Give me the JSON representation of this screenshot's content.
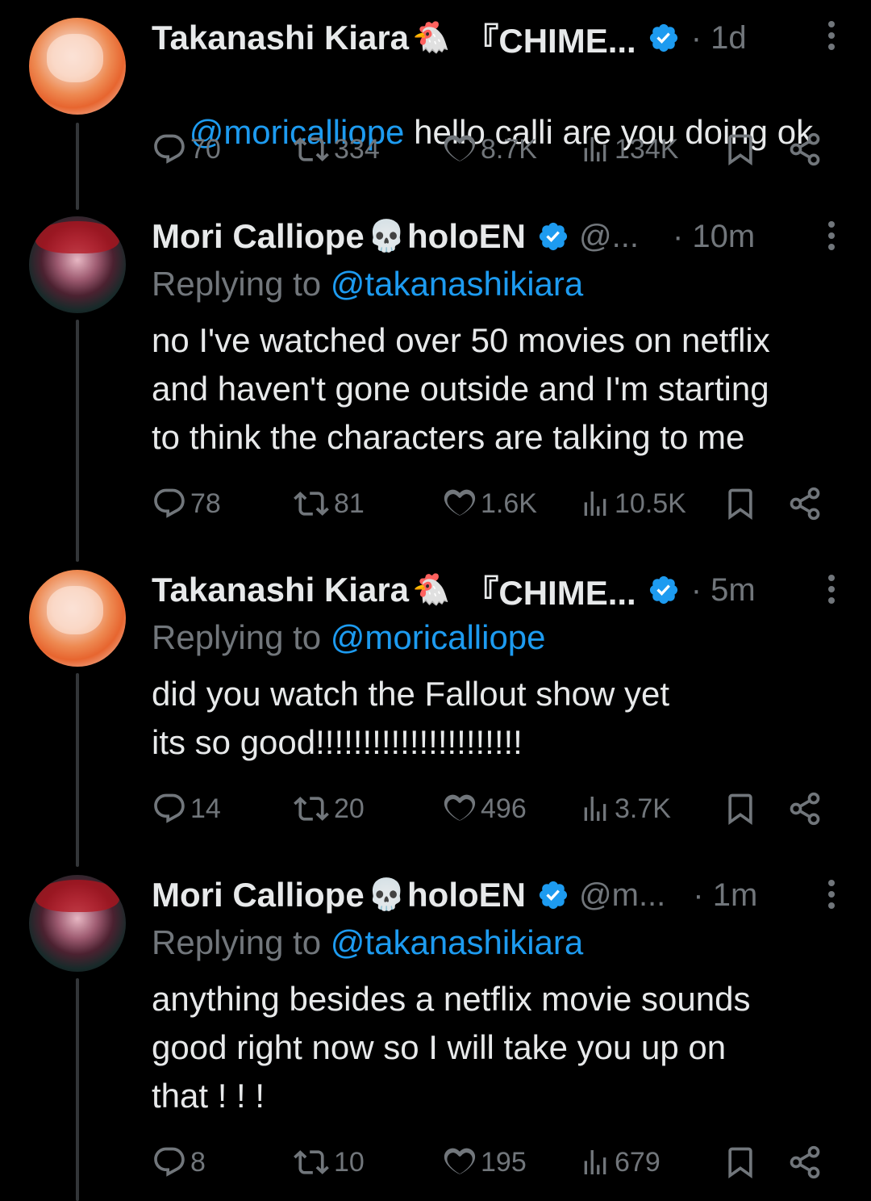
{
  "tweets": [
    {
      "name": "Takanashi Kiara",
      "emoji": "🐔",
      "extra_name": "『CHIME...",
      "handle": "",
      "time": "· 1d",
      "reply_prefix": "",
      "reply_handle": "",
      "mention": "@moricalliope",
      "text": " hello calli are you doing ok",
      "replies": "70",
      "retweets": "334",
      "likes": "8.7K",
      "views": "134K"
    },
    {
      "name": "Mori Calliope",
      "emoji": "💀",
      "extra_name": "holoEN",
      "handle": "@...",
      "time": "· 10m",
      "reply_prefix": "Replying to ",
      "reply_handle": "@takanashikiara",
      "text": "no I've watched over 50 movies on netflix\nand haven't gone outside and I'm starting\nto think the characters are talking to me",
      "replies": "78",
      "retweets": "81",
      "likes": "1.6K",
      "views": "10.5K"
    },
    {
      "name": "Takanashi Kiara",
      "emoji": "🐔",
      "extra_name": "『CHIME...",
      "handle": "",
      "time": "· 5m",
      "reply_prefix": "Replying to ",
      "reply_handle": "@moricalliope",
      "text": "did you watch the Fallout show yet\nits so good!!!!!!!!!!!!!!!!!!!!!!",
      "replies": "14",
      "retweets": "20",
      "likes": "496",
      "views": "3.7K"
    },
    {
      "name": "Mori Calliope",
      "emoji": "💀",
      "extra_name": "holoEN",
      "handle": "@m...",
      "time": "· 1m",
      "reply_prefix": "Replying to ",
      "reply_handle": "@takanashikiara",
      "text": "anything besides a netflix movie sounds\ngood right now so I will take you up on\nthat ! ! !",
      "replies": "8",
      "retweets": "10",
      "likes": "195",
      "views": "679"
    }
  ],
  "icons": {
    "verified": "verified-badge-icon",
    "reply": "reply-icon",
    "retweet": "retweet-icon",
    "like": "heart-icon",
    "views": "views-icon",
    "bookmark": "bookmark-icon",
    "share": "share-icon",
    "more": "more-icon"
  },
  "colors": {
    "background": "#000000",
    "text": "#e7e9ea",
    "muted": "#71767b",
    "link": "#1d9bf0",
    "thread_line": "#333639"
  }
}
